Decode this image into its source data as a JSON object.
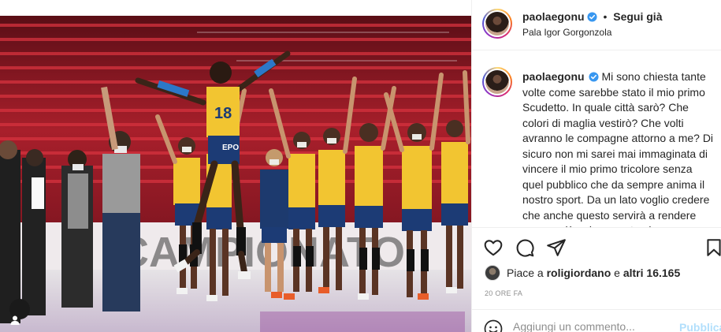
{
  "header": {
    "username": "paolaegonu",
    "separator": "•",
    "follow_label": "Segui già",
    "location": "Pala Igor Gorgonzola"
  },
  "caption": {
    "username": "paolaegonu",
    "text": "Mi sono chiesta tante volte come sarebbe stato il mio primo Scudetto. In quale città sarò? Che colori di maglia vestirò? Che volti avranno le compagne attorno a me? Di sicuro non mi sarei mai immaginata di vincere il mio primo tricolore senza quel pubblico che da sempre anima il nostro sport. Da un lato voglio credere che anche questo servirà a rendere ancora più unico questo giorno,"
  },
  "actions": {
    "icons": [
      "heart-icon",
      "comment-icon",
      "share-icon",
      "bookmark-icon"
    ]
  },
  "likes": {
    "prefix": "Piace a",
    "user": "roligiordano",
    "connector": "e",
    "others": "altri 16.165"
  },
  "timestamp": "20 ORE FA",
  "comment": {
    "placeholder": "Aggiungi un commento...",
    "publish_label": "Pubblica"
  },
  "photo": {
    "jersey_number": "18",
    "banner_text": "CAMPIONATO",
    "sponsor_text": "EPO",
    "tag_icon": "user-tag-icon"
  },
  "colors": {
    "verified": "#3897f0",
    "publish": "#b2dffc",
    "seats_red": "#b8232f",
    "jersey_yellow": "#f2c531",
    "shorts_blue": "#1c3b75"
  }
}
